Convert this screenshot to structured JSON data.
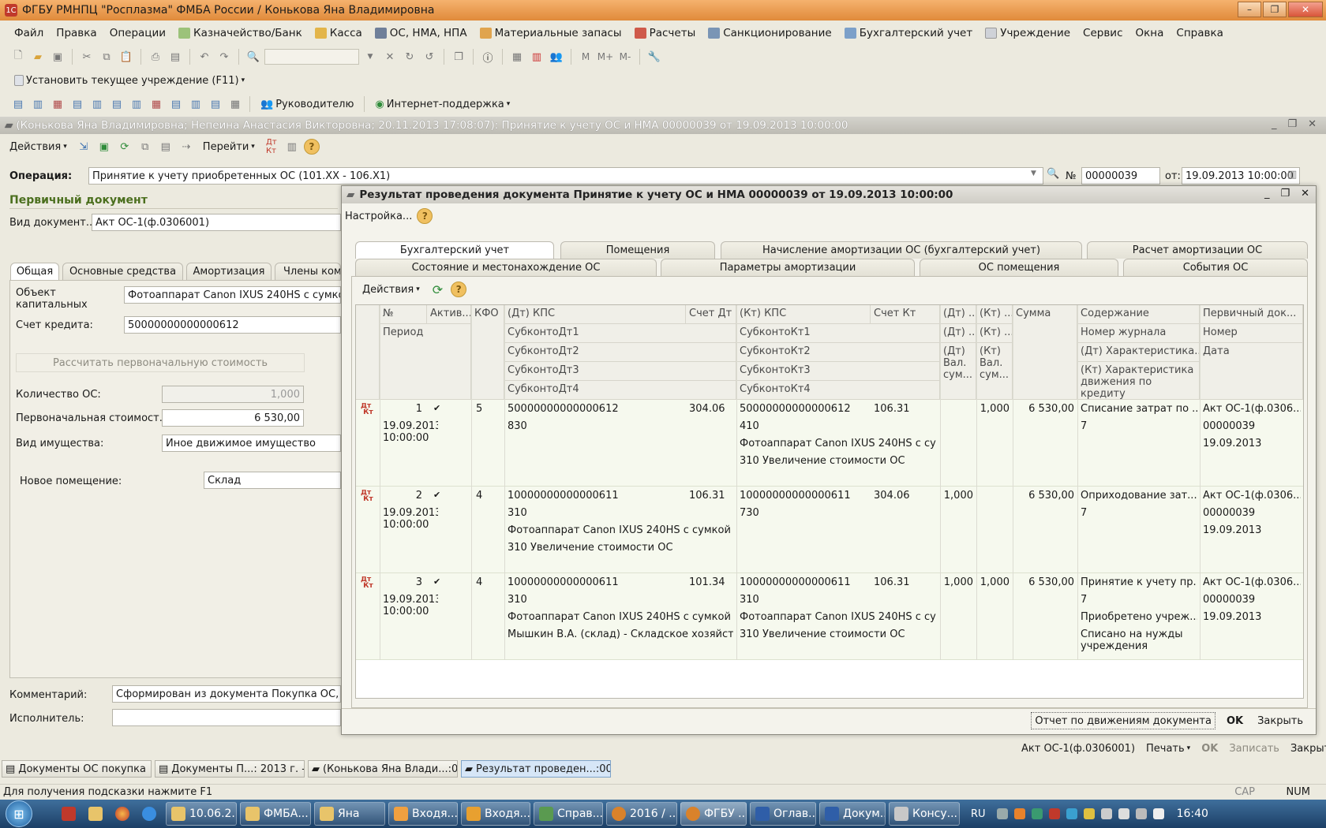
{
  "window": {
    "title": "ФГБУ РМНПЦ \"Росплазма\" ФМБА России / Конькова Яна Владимировна",
    "min": "–",
    "max": "❐",
    "close": "✕"
  },
  "menu": [
    "Файл",
    "Правка",
    "Операции",
    "Казначейство/Банк",
    "Касса",
    "ОС, НМА, НПА",
    "Материальные запасы",
    "Расчеты",
    "Санкционирование",
    "Бухгалтерский учет",
    "Учреждение",
    "Сервис",
    "Окна",
    "Справка"
  ],
  "toolbar2": {
    "set_institution": "Установить текущее учреждение (F11)"
  },
  "toolbar3": {
    "manager": "Руководителю",
    "internet": "Интернет-поддержка"
  },
  "doc": {
    "title": "(Конькова Яна Владимировна; Непеина Анастасия Викторовна; 20.11.2013 17:08:07): Принятие к учету ОС и НМА 00000039 от 19.09.2013 10:00:00",
    "actions": "Действия",
    "goto": "Перейти",
    "operation_label": "Операция:",
    "operation_value": "Принятие к учету приобретенных ОС (101.XX - 106.X1)",
    "no_label": "№",
    "no_value": "00000039",
    "date_label": "от:",
    "date_value": "19.09.2013 10:00:00",
    "primary_header": "Первичный документ",
    "doc_type_label": "Вид документ...",
    "doc_type_value": "Акт ОС-1(ф.0306001)",
    "tabs": [
      "Общая",
      "Основные средства",
      "Амортизация",
      "Члены ком"
    ],
    "capital_label": "Объект капитальных",
    "capital_value": "Фотоаппарат Canon IXUS 240HS с сумкой",
    "credit_label": "Счет кредита:",
    "credit_value": "50000000000000612",
    "calc_button": "Рассчитать первоначальную стоимость",
    "qty_label": "Количество ОС:",
    "qty_value": "1,000",
    "initcost_label": "Первоначальная стоимост...",
    "initcost_value": "6 530,00",
    "property_label": "Вид имущества:",
    "property_value": "Иное движимое имущество",
    "room_label": "Новое помещение:",
    "room_value": "Склад",
    "comment_label": "Комментарий:",
    "comment_value": "Сформирован из документа Покупка ОС, Н",
    "executor_label": "Исполнитель:",
    "executor_value": "",
    "bottom": {
      "form": "Акт ОС-1(ф.0306001)",
      "print": "Печать",
      "ok": "OK",
      "save": "Записать",
      "close": "Закрыть"
    }
  },
  "dialog": {
    "title": "Результат проведения документа Принятие к учету ОС и НМА 00000039 от 19.09.2013 10:00:00",
    "settings": "Настройка...",
    "tabs_row1": [
      "Бухгалтерский учет",
      "Помещения",
      "Начисление амортизации ОС (бухгалтерский учет)",
      "Расчет амортизации ОС"
    ],
    "tabs_row2": [
      "Состояние и местонахождение ОС",
      "Параметры амортизации",
      "ОС помещения",
      "События ОС"
    ],
    "actions": "Действия",
    "headers": {
      "no": "№",
      "period": "Период",
      "active": "Актив...",
      "kfo": "КФО",
      "dt_kps": "(Дт) КПС",
      "sub_dt1": "СубконтоДт1",
      "sub_dt2": "СубконтоДт2",
      "sub_dt3": "СубконтоДт3",
      "sub_dt4": "СубконтоДт4",
      "acc_dt": "Счет Дт",
      "kt_kps": "(Кт) КПС",
      "sub_kt1": "СубконтоКт1",
      "sub_kt2": "СубконтоКт2",
      "sub_kt3": "СубконтоКт3",
      "sub_kt4": "СубконтоКт4",
      "acc_kt": "Счет Кт",
      "dt_q": "(Дт) ...",
      "dt_q2": "(Дт) ...",
      "dt_val": "(Дт) Вал. сум...",
      "kt_q": "(Кт) ...",
      "kt_q2": "(Кт) ...",
      "kt_val": "(Кт) Вал. сум...",
      "sum": "Сумма",
      "content": "Содержание",
      "journal": "Номер журнала",
      "dt_char": "(Дт) Характеристика...",
      "kt_char": "(Кт) Характеристика движения по кредиту",
      "primary": "Первичный док...",
      "number": "Номер",
      "date": "Дата"
    },
    "rows": [
      {
        "no": "1",
        "period": "19.09.2013 10:00:00",
        "active": "✔",
        "kfo": "5",
        "dt_kps": "50000000000000612",
        "sub_dt1": "830",
        "sub_dt2": "",
        "sub_dt3": "",
        "acc_dt": "304.06",
        "kt_kps": "50000000000000612",
        "sub_kt1": "410",
        "sub_kt2": "Фотоаппарат Canon IXUS 240HS с су...",
        "sub_kt3": "310 Увеличение стоимости ОС",
        "acc_kt": "106.31",
        "dt_q": "",
        "kt_q": "1,000",
        "sum": "6 530,00",
        "content": "Списание затрат по ...",
        "journal": "7",
        "content3": "",
        "content4": "",
        "primary": "Акт ОС-1(ф.0306...",
        "number": "00000039",
        "date": "19.09.2013"
      },
      {
        "no": "2",
        "period": "19.09.2013 10:00:00",
        "active": "✔",
        "kfo": "4",
        "dt_kps": "10000000000000611",
        "sub_dt1": "310",
        "sub_dt2": "Фотоаппарат Canon IXUS 240HS с сумкой ...",
        "sub_dt3": "310 Увеличение стоимости ОС",
        "acc_dt": "106.31",
        "kt_kps": "10000000000000611",
        "sub_kt1": "730",
        "sub_kt2": "",
        "sub_kt3": "",
        "acc_kt": "304.06",
        "dt_q": "1,000",
        "kt_q": "",
        "sum": "6 530,00",
        "content": "Оприходование зат...",
        "journal": "7",
        "content3": "",
        "content4": "",
        "primary": "Акт ОС-1(ф.0306...",
        "number": "00000039",
        "date": "19.09.2013"
      },
      {
        "no": "3",
        "period": "19.09.2013 10:00:00",
        "active": "✔",
        "kfo": "4",
        "dt_kps": "10000000000000611",
        "sub_dt1": "310",
        "sub_dt2": "Фотоаппарат Canon IXUS 240HS с сумкой ...",
        "sub_dt3": "Мышкин В.А. (склад) - Складское хозяйство",
        "acc_dt": "101.34",
        "kt_kps": "10000000000000611",
        "sub_kt1": "310",
        "sub_kt2": "Фотоаппарат Canon IXUS 240HS с су...",
        "sub_kt3": "310 Увеличение стоимости ОС",
        "acc_kt": "106.31",
        "dt_q": "1,000",
        "kt_q": "1,000",
        "sum": "6 530,00",
        "content": "Принятие к учету пр...",
        "journal": "7",
        "content3": "Приобретено учреж...",
        "content4": "Списано на нужды учреждения",
        "primary": "Акт ОС-1(ф.0306...",
        "number": "00000039",
        "date": "19.09.2013"
      }
    ],
    "report_button": "Отчет по движениям документа",
    "ok": "OK",
    "close": "Закрыть"
  },
  "taskpane": [
    "Документы ОС покупка",
    "Документы П...: 2013 г. - ...",
    "(Конькова Яна Влади...:00",
    "Результат проведен...:00"
  ],
  "hint": "Для получения подсказки нажмите F1",
  "status": {
    "cap": "CAP",
    "num": "NUM"
  },
  "taskbar": {
    "items": [
      "10.06.2...",
      "ФМБА...",
      "Яна",
      "Входя...",
      "Входя...",
      "Справ...",
      "2016 / ...",
      "ФГБУ ...",
      "Оглав...",
      "Докум...",
      "Консу..."
    ],
    "lang": "RU",
    "time": "16:40"
  },
  "colors": {
    "accent": "#e08a3a",
    "green_header": "#4b6f1e",
    "row_bg": "#f6f9ee"
  }
}
